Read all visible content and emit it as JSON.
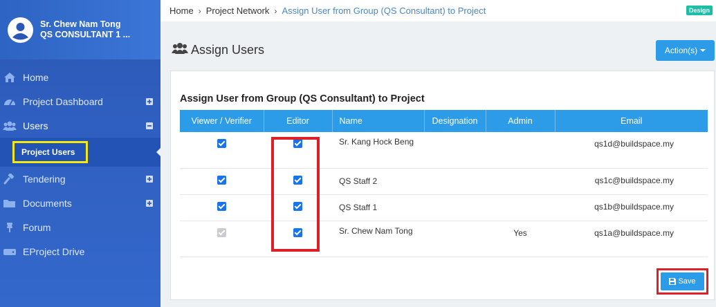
{
  "user": {
    "name": "Sr. Chew Nam Tong",
    "role": "QS CONSULTANT 1 ..."
  },
  "nav": [
    {
      "label": "Home",
      "icon": "home-icon",
      "expandable": false
    },
    {
      "label": "Project Dashboard",
      "icon": "dashboard-icon",
      "expandable": true
    },
    {
      "label": "Users",
      "icon": "users-icon",
      "expandable": true,
      "expanded": true
    },
    {
      "label": "Tendering",
      "icon": "gavel-icon",
      "expandable": true
    },
    {
      "label": "Documents",
      "icon": "folder-icon",
      "expandable": true
    },
    {
      "label": "Forum",
      "icon": "pin-icon",
      "expandable": false
    },
    {
      "label": "EProject Drive",
      "icon": "drive-icon",
      "expandable": false
    }
  ],
  "sub_nav": {
    "project_users": "Project Users"
  },
  "breadcrumb": [
    "Home",
    "Project Network",
    "Assign User from Group (QS Consultant) to Project"
  ],
  "badge": "Design",
  "page_title": "Assign Users",
  "action_button": "Action(s)",
  "panel_title": "Assign User from Group (QS Consultant) to Project",
  "table": {
    "headers": [
      "Viewer / Verifier",
      "Editor",
      "Name",
      "Designation",
      "Admin",
      "Email"
    ],
    "rows": [
      {
        "viewer": true,
        "viewer_disabled": false,
        "editor": true,
        "name": "Sr. Kang Hock Beng",
        "designation": "",
        "admin": "",
        "email": "qs1d@buildspace.my"
      },
      {
        "viewer": true,
        "viewer_disabled": false,
        "editor": true,
        "name": "QS Staff 2",
        "designation": "",
        "admin": "",
        "email": "qs1c@buildspace.my"
      },
      {
        "viewer": true,
        "viewer_disabled": false,
        "editor": true,
        "name": "QS Staff 1",
        "designation": "",
        "admin": "",
        "email": "qs1b@buildspace.my"
      },
      {
        "viewer": true,
        "viewer_disabled": true,
        "editor": true,
        "name": "Sr. Chew Nam Tong",
        "designation": "",
        "admin": "Yes",
        "email": "qs1a@buildspace.my"
      }
    ]
  },
  "save_button": "Save",
  "colors": {
    "accent": "#2d9ce8",
    "sidebar": "#2f5fc0",
    "highlight_red": "#dd1f27",
    "highlight_yellow": "#f5e90f",
    "badge": "#1cbfa5"
  }
}
